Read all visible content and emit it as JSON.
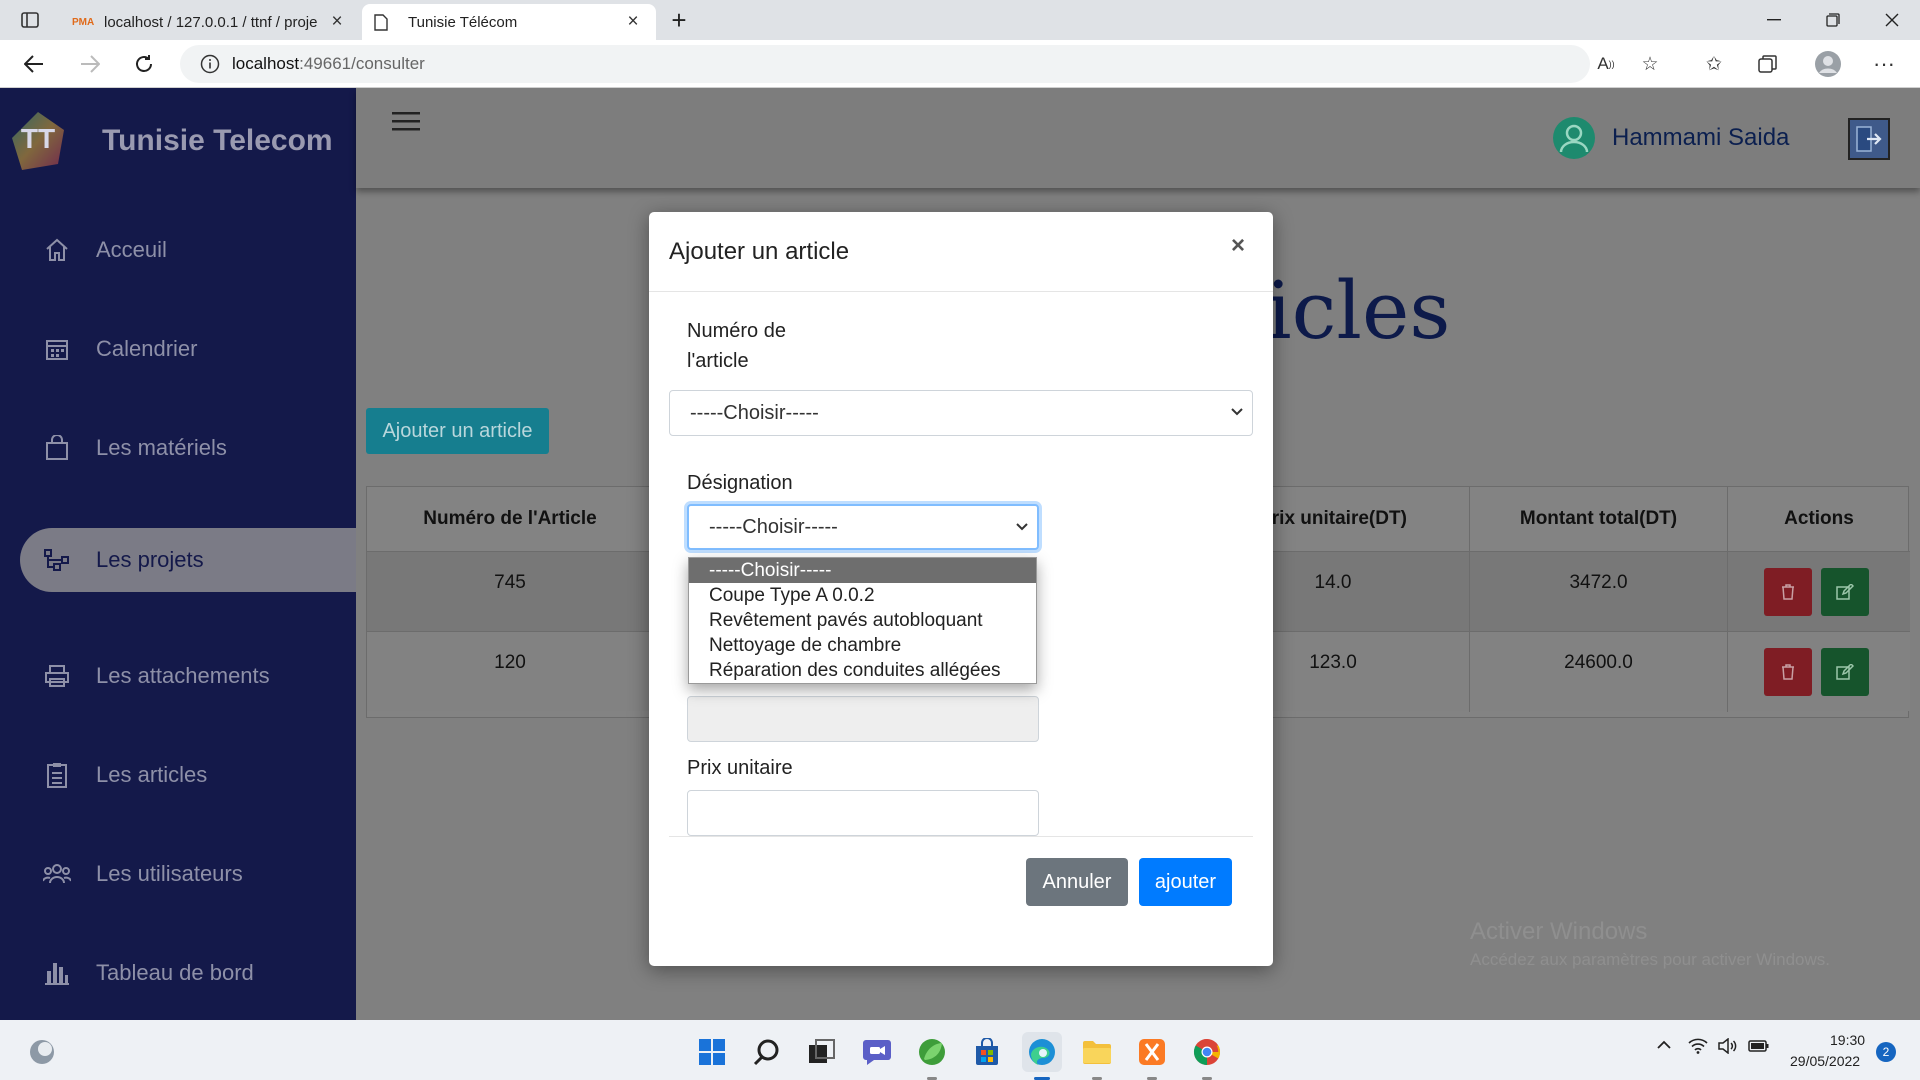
{
  "browser": {
    "tabs": [
      {
        "title": "localhost / 127.0.0.1 / ttnf / proje",
        "active": false
      },
      {
        "title": "Tunisie Télécom",
        "active": true
      }
    ],
    "new_tab": "+",
    "address": {
      "host": "localhost",
      "rest": ":49661/consulter"
    }
  },
  "sidebar": {
    "brand": "Tunisie Telecom",
    "logo_text": "TT",
    "items": [
      {
        "label": "Acceuil",
        "icon": "home-icon"
      },
      {
        "label": "Calendrier",
        "icon": "calendar-icon"
      },
      {
        "label": "Les matériels",
        "icon": "shopping-bag-icon"
      },
      {
        "label": "Les projets",
        "icon": "project-tree-icon",
        "active": true
      },
      {
        "label": "Les attachements",
        "icon": "printer-icon"
      },
      {
        "label": "Les articles",
        "icon": "clipboard-icon"
      },
      {
        "label": "Les utilisateurs",
        "icon": "users-icon"
      },
      {
        "label": "Tableau de bord",
        "icon": "bar-chart-icon"
      }
    ]
  },
  "header": {
    "user_name": "Hammami Saida"
  },
  "main": {
    "heading_visible": "icles",
    "add_button": "Ajouter un article",
    "table": {
      "columns": [
        "Numéro de l'Article",
        "Prix unitaire(DT)",
        "Montant total(DT)",
        "Actions"
      ],
      "rows": [
        {
          "numero": "745",
          "prix": "14.0",
          "montant": "3472.0"
        },
        {
          "numero": "120",
          "prix": "123.0",
          "montant": "24600.0"
        }
      ]
    }
  },
  "modal": {
    "title": "Ajouter un article",
    "close": "×",
    "numero_label_line1": "Numéro de",
    "numero_label_line2": "l'article",
    "numero_select_value": "-----Choisir-----",
    "designation_label": "Désignation",
    "designation_select_value": "-----Choisir-----",
    "designation_options": [
      "-----Choisir-----",
      "Coupe Type A 0.0.2",
      "Revêtement pavés autobloquant",
      "Nettoyage de chambre",
      "Réparation des conduites allégées"
    ],
    "prix_label": "Prix unitaire",
    "cancel_label": "Annuler",
    "submit_label": "ajouter"
  },
  "windows": {
    "watermark_title": "Activer Windows",
    "watermark_sub": "Accédez aux paramètres pour activer Windows.",
    "time": "19:30",
    "date": "29/05/2022",
    "notifications": "2"
  }
}
